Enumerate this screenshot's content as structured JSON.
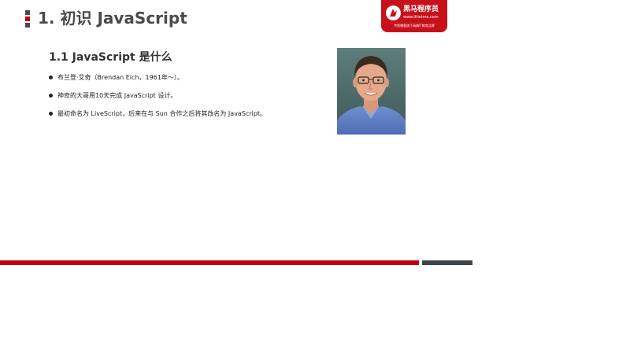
{
  "header": {
    "title": "1. 初识 JavaScript"
  },
  "logo": {
    "name": "黑马程序员",
    "url": "www.itheima.com",
    "slogan": "传智播客旗下高端IT教育品牌"
  },
  "section": {
    "title": "1.1 JavaScript 是什么",
    "bullets": [
      "布兰登·艾奇（Brendan Eich，1961年～）。",
      "神奇的大哥用10天完成 JavaScript 设计。",
      "最初命名为 LiveScript，后来在与 Sun 合作之后将其改名为 JavaScript。"
    ]
  },
  "colors": {
    "accent_red": "#c0000b",
    "dark_gray": "#3f4449",
    "title_gray": "#4a4a4a"
  },
  "icons": {
    "header_marker": "section-marker-icon",
    "logo_mark": "itheima-logo-icon",
    "bullet": "bullet-dot-icon"
  }
}
